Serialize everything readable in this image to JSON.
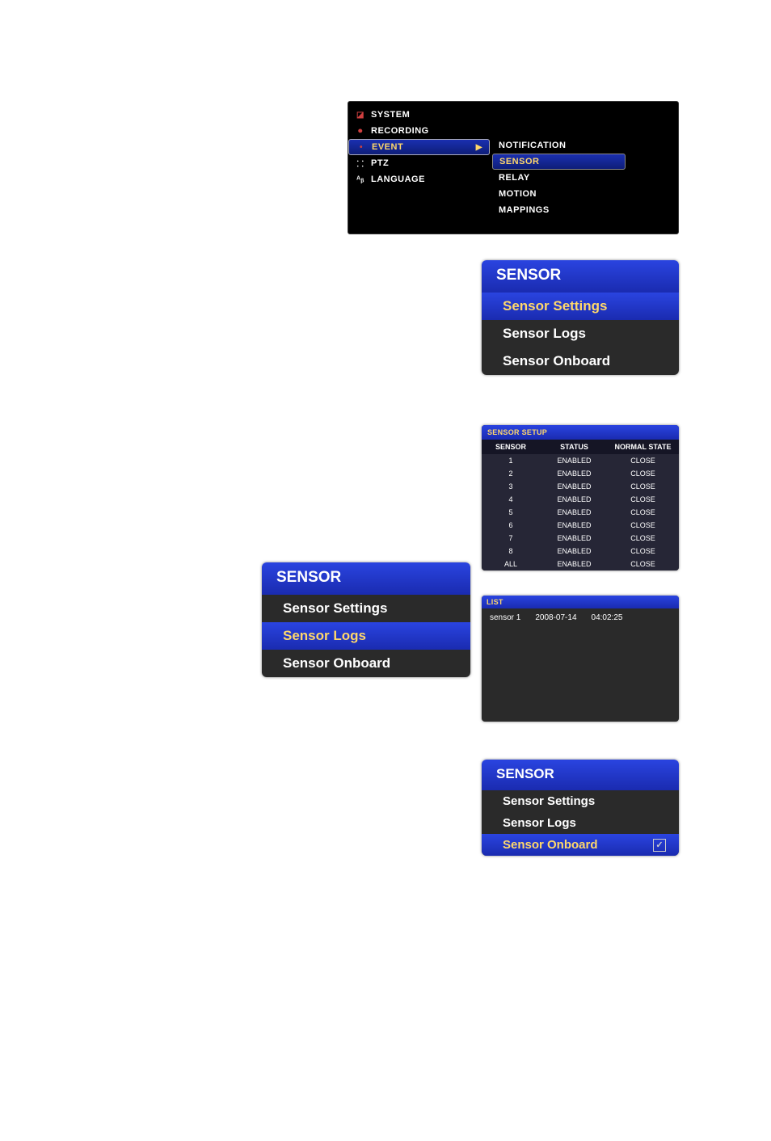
{
  "main_nav_left": [
    {
      "label": "SYSTEM",
      "icon": "◪",
      "active": false
    },
    {
      "label": "RECORDING",
      "icon": "⏺",
      "active": false
    },
    {
      "label": "EVENT",
      "icon": "•",
      "active": true
    },
    {
      "label": "PTZ",
      "icon": "⸬",
      "active": false
    },
    {
      "label": "LANGUAGE",
      "icon": "ᴬᵦ",
      "active": false
    }
  ],
  "main_nav_right": [
    {
      "label": "NOTIFICATION",
      "active": false
    },
    {
      "label": "SENSOR",
      "active": true
    },
    {
      "label": "RELAY",
      "active": false
    },
    {
      "label": "MOTION",
      "active": false
    },
    {
      "label": "MAPPINGS",
      "active": false
    }
  ],
  "sensor_panel_a": {
    "title": "SENSOR",
    "items": [
      {
        "label": "Sensor Settings",
        "highlight": true
      },
      {
        "label": "Sensor Logs",
        "highlight": false
      },
      {
        "label": "Sensor Onboard",
        "highlight": false
      }
    ]
  },
  "sensor_setup": {
    "title": "SENSOR SETUP",
    "headers": {
      "c1": "SENSOR",
      "c2": "STATUS",
      "c3": "NORMAL STATE"
    },
    "rows": [
      {
        "c1": "1",
        "c2": "ENABLED",
        "c3": "CLOSE"
      },
      {
        "c1": "2",
        "c2": "ENABLED",
        "c3": "CLOSE"
      },
      {
        "c1": "3",
        "c2": "ENABLED",
        "c3": "CLOSE"
      },
      {
        "c1": "4",
        "c2": "ENABLED",
        "c3": "CLOSE"
      },
      {
        "c1": "5",
        "c2": "ENABLED",
        "c3": "CLOSE"
      },
      {
        "c1": "6",
        "c2": "ENABLED",
        "c3": "CLOSE"
      },
      {
        "c1": "7",
        "c2": "ENABLED",
        "c3": "CLOSE"
      },
      {
        "c1": "8",
        "c2": "ENABLED",
        "c3": "CLOSE"
      },
      {
        "c1": "ALL",
        "c2": "ENABLED",
        "c3": "CLOSE"
      }
    ]
  },
  "sensor_panel_b": {
    "title": "SENSOR",
    "items": [
      {
        "label": "Sensor Settings",
        "highlight": false
      },
      {
        "label": "Sensor Logs",
        "highlight": true
      },
      {
        "label": "Sensor Onboard",
        "highlight": false
      }
    ]
  },
  "list_panel": {
    "title": "LIST",
    "rows": [
      {
        "name": "sensor 1",
        "date": "2008-07-14",
        "time": "04:02:25"
      }
    ]
  },
  "sensor_panel_c": {
    "title": "SENSOR",
    "items": [
      {
        "label": "Sensor Settings",
        "highlight": false,
        "check": false
      },
      {
        "label": "Sensor Logs",
        "highlight": false,
        "check": false
      },
      {
        "label": "Sensor Onboard",
        "highlight": true,
        "check": true
      }
    ]
  }
}
